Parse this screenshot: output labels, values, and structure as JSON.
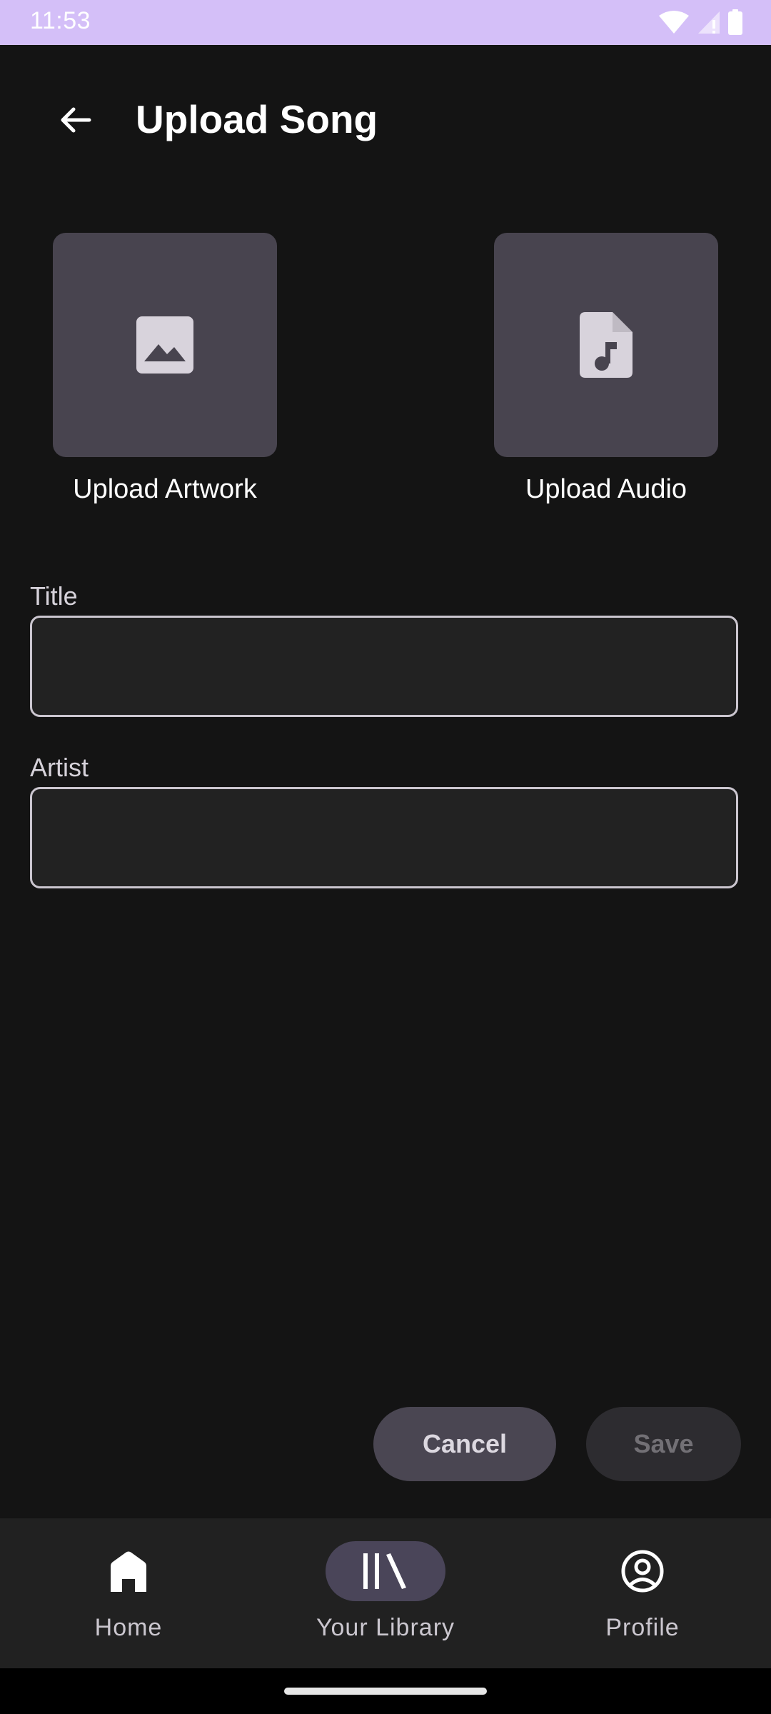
{
  "status_bar": {
    "time": "11:53"
  },
  "header": {
    "title": "Upload Song"
  },
  "uploads": {
    "artwork_label": "Upload Artwork",
    "audio_label": "Upload Audio"
  },
  "form": {
    "title_label": "Title",
    "title_value": "",
    "artist_label": "Artist",
    "artist_value": ""
  },
  "actions": {
    "cancel_label": "Cancel",
    "save_label": "Save"
  },
  "nav": {
    "items": [
      {
        "label": "Home",
        "icon": "home-icon",
        "selected": false
      },
      {
        "label": "Your Library",
        "icon": "library-icon",
        "selected": true
      },
      {
        "label": "Profile",
        "icon": "profile-icon",
        "selected": false
      }
    ]
  },
  "colors": {
    "background": "#141414",
    "status_bar": "#d4bff8",
    "tile": "#48444f",
    "nav_bar": "#212121",
    "nav_selected_pill": "#4a4559"
  }
}
